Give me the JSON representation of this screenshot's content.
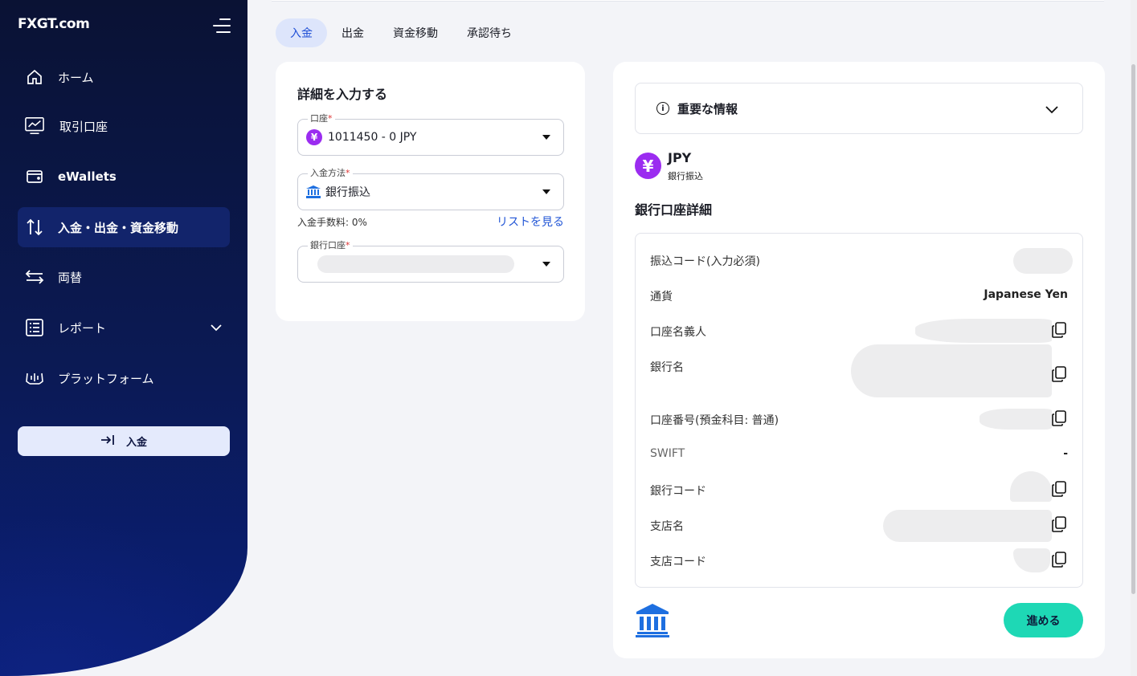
{
  "brand": {
    "logo_text": "FXGT",
    "logo_domain": ".com"
  },
  "sidebar": {
    "items": [
      {
        "label": "ホーム",
        "icon": "home-icon"
      },
      {
        "label": "取引口座",
        "icon": "chart-monitor-icon"
      },
      {
        "label": "eWallets",
        "icon": "wallet-icon"
      },
      {
        "label": "入金・出金・資金移動",
        "icon": "arrows-updown-icon",
        "active": true
      },
      {
        "label": "両替",
        "icon": "exchange-icon"
      },
      {
        "label": "レポート",
        "icon": "report-list-icon"
      },
      {
        "label": "プラットフォーム",
        "icon": "platform-icon"
      }
    ],
    "deposit_button": "入金"
  },
  "tabs": [
    {
      "label": "入金",
      "active": true
    },
    {
      "label": "出金"
    },
    {
      "label": "資金移動"
    },
    {
      "label": "承認待ち"
    }
  ],
  "form": {
    "title": "詳細を入力する",
    "account_label": "口座",
    "account_value": "1011450 - 0 JPY",
    "method_label": "入金方法",
    "method_value": "銀行振込",
    "fee_text": "入金手数料: 0%",
    "list_link": "リストを見る",
    "bank_account_label": "銀行口座",
    "required_mark": "*"
  },
  "info": {
    "important_title": "重要な情報",
    "currency_code": "JPY",
    "currency_symbol": "¥",
    "method": "銀行振込",
    "detail_title": "銀行口座詳細",
    "rows": [
      {
        "label": "振込コード(入力必須)",
        "value": ""
      },
      {
        "label": "通貨",
        "value": "Japanese Yen"
      },
      {
        "label": "口座名義人",
        "value": ""
      },
      {
        "label": "銀行名",
        "value": ""
      },
      {
        "label": "口座番号(預金科目: 普通)",
        "value": ""
      },
      {
        "label": "SWIFT",
        "value": "-"
      },
      {
        "label": "銀行コード",
        "value": ""
      },
      {
        "label": "支店名",
        "value": ""
      },
      {
        "label": "支店コード",
        "value": ""
      }
    ],
    "proceed_button": "進める"
  },
  "colors": {
    "accent": "#1f4fd6",
    "proceed": "#1ed8b5",
    "yen_badge": "#9b2cf0",
    "sidebar": "#0b1a55"
  }
}
